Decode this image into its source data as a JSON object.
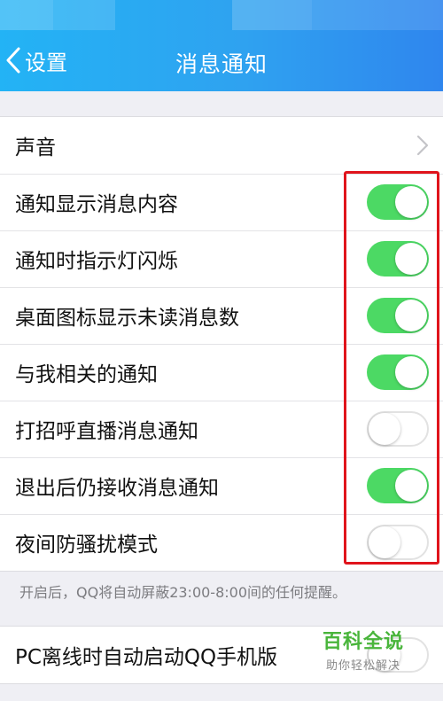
{
  "header": {
    "back_label": "设置",
    "title": "消息通知",
    "background_color": "#2fa2f0"
  },
  "settings": {
    "sound_label": "声音",
    "toggles": [
      {
        "label": "通知显示消息内容",
        "on": true
      },
      {
        "label": "通知时指示灯闪烁",
        "on": true
      },
      {
        "label": "桌面图标显示未读消息数",
        "on": true
      },
      {
        "label": "与我相关的通知",
        "on": true
      },
      {
        "label": "打招呼直播消息通知",
        "on": false
      },
      {
        "label": "退出后仍接收消息通知",
        "on": true
      },
      {
        "label": "夜间防骚扰模式",
        "on": false
      }
    ],
    "night_mode_note": "开启后，QQ将自动屏蔽23:00-8:00间的任何提醒。",
    "pc_offline": {
      "label": "PC离线时自动启动QQ手机版",
      "on": false
    }
  },
  "watermark": {
    "title": "百科全说",
    "subtitle": "助你轻松解决"
  },
  "colors": {
    "toggle_on": "#4cd964",
    "highlight_box": "#e0141c",
    "watermark": "#49b53b"
  },
  "icons": [
    "chevron-left-icon",
    "chevron-right-icon"
  ]
}
